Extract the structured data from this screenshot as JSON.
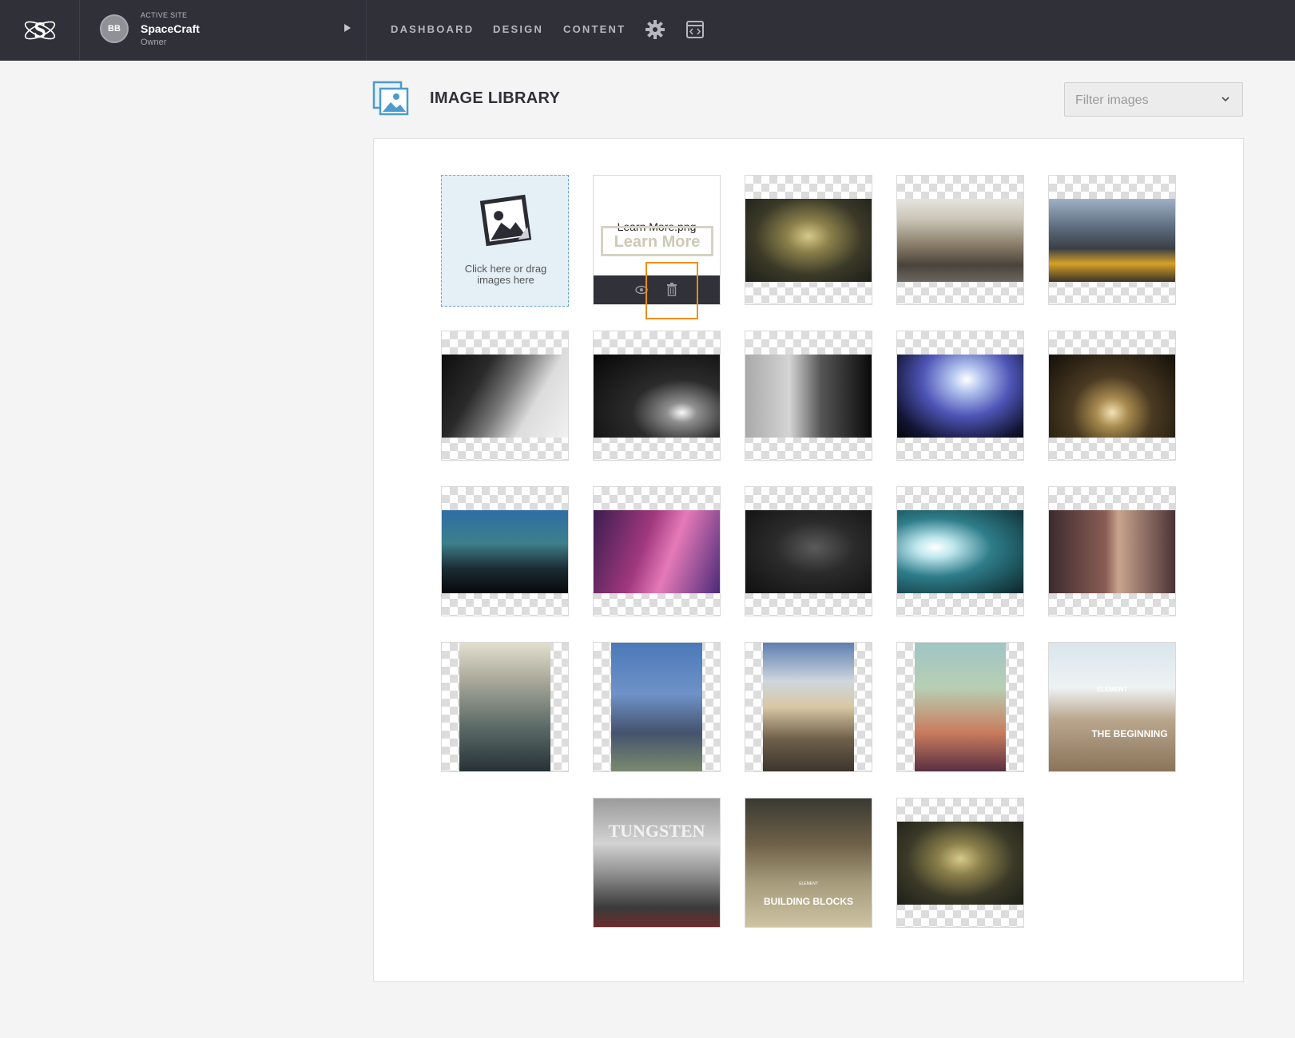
{
  "topbar": {
    "active_site_label": "ACTIVE SITE",
    "site_name": "SpaceCraft",
    "site_role": "Owner",
    "avatar_initials": "BB",
    "nav": [
      "DASHBOARD",
      "DESIGN",
      "CONTENT"
    ],
    "icons": [
      "settings-gear-icon",
      "code-embed-icon"
    ]
  },
  "page": {
    "title": "IMAGE LIBRARY",
    "filter_placeholder": "Filter images"
  },
  "upload": {
    "text": "Click here or drag images here"
  },
  "learn_more": {
    "file_name": "Learn More.png",
    "button_text": "Learn More"
  },
  "images": [
    {
      "subject": "subway-car-interior"
    },
    {
      "subject": "city-street"
    },
    {
      "subject": "yellow-taxis"
    },
    {
      "subject": "guitar-bw"
    },
    {
      "subject": "band-on-stage-bw"
    },
    {
      "subject": "microphone-bw"
    },
    {
      "subject": "concert-lights"
    },
    {
      "subject": "dark-stage"
    },
    {
      "subject": "crowd-blue-lights"
    },
    {
      "subject": "dj-pink-lights"
    },
    {
      "subject": "headphones-bw"
    },
    {
      "subject": "dj-headphones"
    },
    {
      "subject": "guitarist"
    },
    {
      "subject": "shanghai-skyline"
    },
    {
      "subject": "san-francisco-towers"
    },
    {
      "subject": "eiffel-tower"
    },
    {
      "subject": "empire-state-rainbow"
    },
    {
      "subject": "element-the-beginning",
      "text_top": "ELEMENT",
      "text_main": "THE BEGINNING"
    },
    {
      "subject": "tungsten-poster",
      "text_main": "TUNGSTEN"
    },
    {
      "subject": "building-blocks-poster",
      "text_top": "ELEMENT",
      "text_main": "BUILDING BLOCKS"
    },
    {
      "subject": "subway-car-interior-copy"
    }
  ]
}
